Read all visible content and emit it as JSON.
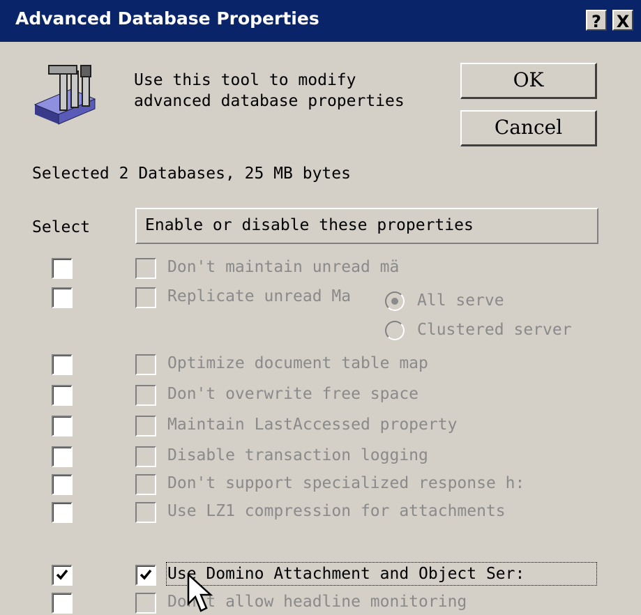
{
  "window": {
    "title": "Advanced Database Properties",
    "help_button": "?",
    "close_button": "X",
    "title_bar_color": "#0a246a"
  },
  "header": {
    "description_line1": "Use this tool to modify",
    "description_line2": "advanced database properties"
  },
  "buttons": {
    "ok_label": "OK",
    "cancel_label": "Cancel"
  },
  "summary_text": "Selected 2 Databases, 25 MB bytes",
  "columns": {
    "select_label": "Select",
    "properties_label": "Enable or disable these properties"
  },
  "properties": [
    {
      "label": "Don't maintain unread mä",
      "selected": false,
      "enabled": false
    },
    {
      "label": "Replicate unread Ma",
      "selected": false,
      "enabled": false
    },
    {
      "label": "Optimize document table map",
      "selected": false,
      "enabled": false
    },
    {
      "label": "Don't overwrite free space",
      "selected": false,
      "enabled": false
    },
    {
      "label": "Maintain LastAccessed property",
      "selected": false,
      "enabled": false
    },
    {
      "label": "Disable transaction logging",
      "selected": false,
      "enabled": false
    },
    {
      "label": "Don't support specialized response h:",
      "selected": false,
      "enabled": false
    },
    {
      "label": "Use LZ1 compression for attachments",
      "selected": false,
      "enabled": false
    },
    {
      "label": "Use Domino Attachment and Object Ser:",
      "selected": true,
      "enabled": true
    },
    {
      "label": "Don't allow headline monitoring",
      "selected": false,
      "enabled": false
    }
  ],
  "replicate_options": {
    "all_servers_label": "All serve",
    "all_servers_selected": true,
    "clustered_label": "Clustered server",
    "clustered_selected": false
  },
  "icons": {
    "app_icon": "database-tools-icon",
    "cursor": "mouse-pointer-icon"
  }
}
